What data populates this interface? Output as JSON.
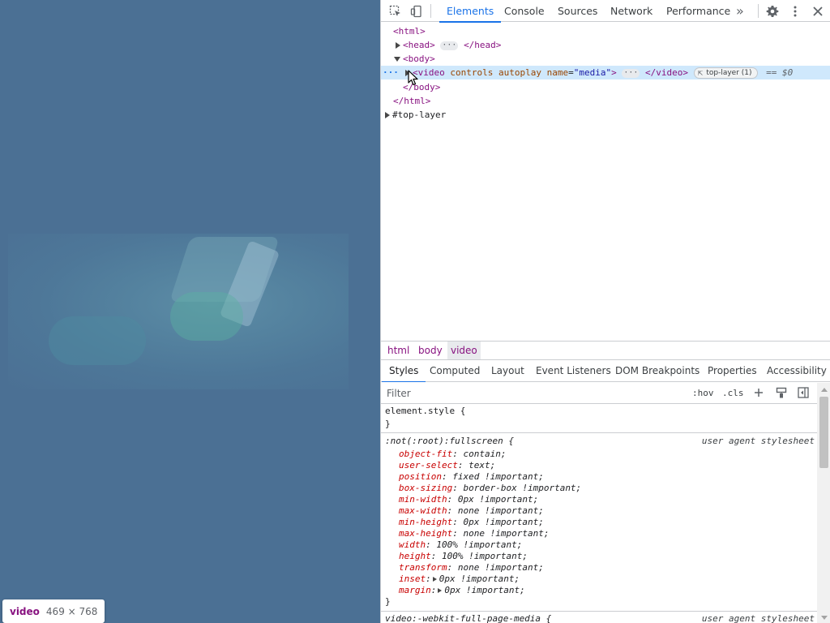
{
  "page": {
    "tooltip": {
      "tag": "video",
      "dims": "469 × 768"
    }
  },
  "devtools": {
    "toolbar": {
      "tabs": [
        "Elements",
        "Console",
        "Sources",
        "Network",
        "Performance"
      ],
      "more_tabs": "»"
    },
    "dom": {
      "html_open": "<html>",
      "head": {
        "open": "<head>",
        "ellipsis": "···",
        "close": "</head>"
      },
      "body_open": "<body>",
      "video": {
        "open_tag": "<video",
        "attr1": "controls",
        "attr2": "autoplay",
        "attr3_name": "name",
        "attr3_value": "\"media\"",
        "gt": ">",
        "ellipsis": "···",
        "close": "</video>",
        "badge": "top-layer (1)",
        "badge_icon": "⇱",
        "eq": "== $0",
        "gutter": "···"
      },
      "body_close": "</body>",
      "html_close": "</html>",
      "top_layer": "#top-layer"
    },
    "breadcrumbs": [
      "html",
      "body",
      "video"
    ],
    "panel_tabs": [
      "Styles",
      "Computed",
      "Layout",
      "Event Listeners",
      "DOM Breakpoints",
      "Properties",
      "Accessibility"
    ],
    "filter": {
      "placeholder": "Filter",
      "hov": ":hov",
      "cls": ".cls"
    },
    "styles": {
      "element_style": {
        "selector": "element.style {",
        "close": "}"
      },
      "fullscreen_rule": {
        "selector": ":not(:root):fullscreen {",
        "origin": "user agent stylesheet",
        "declarations": [
          {
            "name": "object-fit",
            "value": "contain;"
          },
          {
            "name": "user-select",
            "value": "text;"
          },
          {
            "name": "position",
            "value": "fixed !important;"
          },
          {
            "name": "box-sizing",
            "value": "border-box !important;"
          },
          {
            "name": "min-width",
            "value": "0px !important;"
          },
          {
            "name": "max-width",
            "value": "none !important;"
          },
          {
            "name": "min-height",
            "value": "0px !important;"
          },
          {
            "name": "max-height",
            "value": "none !important;"
          },
          {
            "name": "width",
            "value": "100% !important;"
          },
          {
            "name": "height",
            "value": "100% !important;"
          },
          {
            "name": "transform",
            "value": "none !important;"
          },
          {
            "name": "inset",
            "value": "0px !important;"
          },
          {
            "name": "margin",
            "value": "0px !important;"
          }
        ],
        "close": "}"
      },
      "webkit_rule": {
        "selector": "video:-webkit-full-page-media {",
        "origin": "user agent stylesheet"
      }
    }
  }
}
